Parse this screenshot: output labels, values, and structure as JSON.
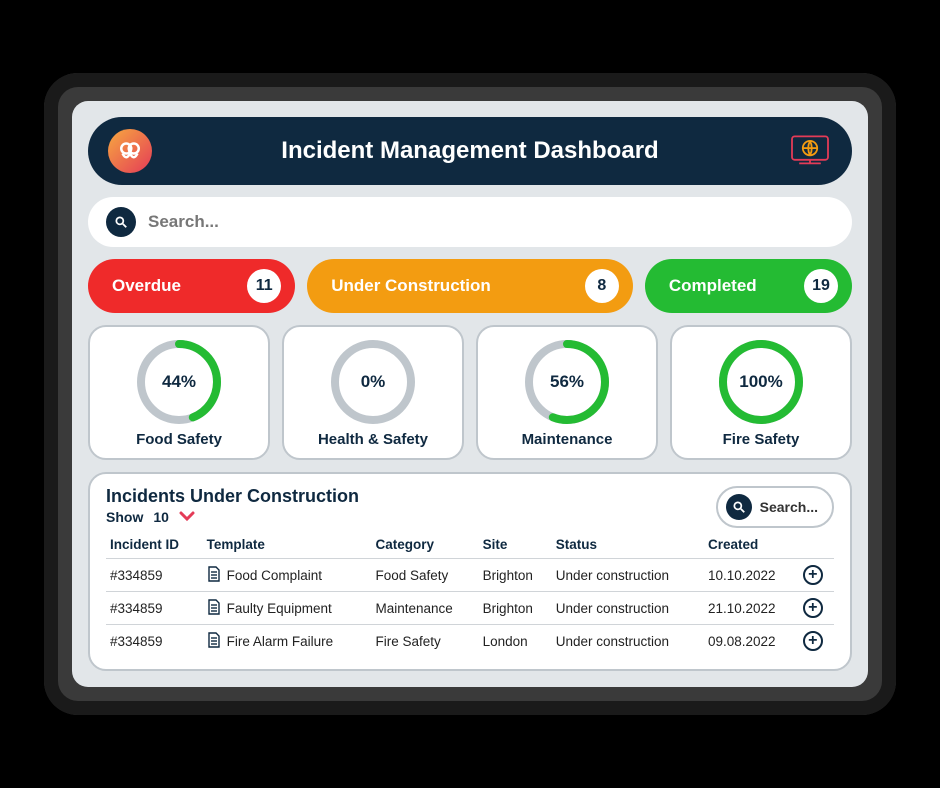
{
  "header": {
    "title": "Incident Management Dashboard"
  },
  "search": {
    "placeholder": "Search..."
  },
  "stats": [
    {
      "label": "Overdue",
      "count": "11",
      "class": "pill-red"
    },
    {
      "label": "Under Construction",
      "count": "8",
      "class": "pill-orange"
    },
    {
      "label": "Completed",
      "count": "19",
      "class": "pill-green"
    }
  ],
  "gauges": [
    {
      "pct": 44,
      "pct_label": "44%",
      "label": "Food Safety"
    },
    {
      "pct": 0,
      "pct_label": "0%",
      "label": "Health & Safety"
    },
    {
      "pct": 56,
      "pct_label": "56%",
      "label": "Maintenance"
    },
    {
      "pct": 100,
      "pct_label": "100%",
      "label": "Fire Safety"
    }
  ],
  "table": {
    "title": "Incidents Under Construction",
    "show_label": "Show",
    "show_value": "10",
    "search_label": "Search...",
    "columns": [
      "Incident ID",
      "Template",
      "Category",
      "Site",
      "Status",
      "Created"
    ],
    "rows": [
      {
        "id": "#334859",
        "template": "Food Complaint",
        "category": "Food Safety",
        "site": "Brighton",
        "status": "Under construction",
        "created": "10.10.2022"
      },
      {
        "id": "#334859",
        "template": "Faulty Equipment",
        "category": "Maintenance",
        "site": "Brighton",
        "status": "Under construction",
        "created": "21.10.2022"
      },
      {
        "id": "#334859",
        "template": "Fire Alarm Failure",
        "category": "Fire Safety",
        "site": "London",
        "status": "Under construction",
        "created": "09.08.2022"
      }
    ]
  }
}
